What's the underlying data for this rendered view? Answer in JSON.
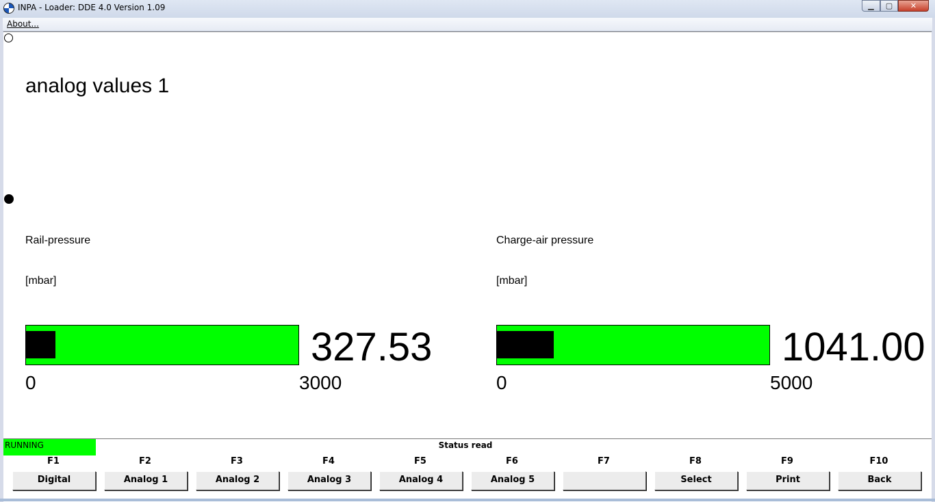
{
  "window": {
    "title": "INPA - Loader:  DDE 4.0 Version 1.09",
    "min_glyph": "▁",
    "max_glyph": "▢",
    "close_glyph": "✕"
  },
  "menu": {
    "about": "About..."
  },
  "page": {
    "title": "analog values 1"
  },
  "gauges": [
    {
      "name": "Rail-pressure",
      "unit": "[mbar]",
      "value": "327.53",
      "min": "0",
      "max": "3000",
      "fill_fraction": 0.1092
    },
    {
      "name": "Charge-air pressure",
      "unit": "[mbar]",
      "value": "1041.00",
      "min": "0",
      "max": "5000",
      "fill_fraction": 0.2082
    }
  ],
  "status": {
    "state": "RUNNING",
    "message": "Status read"
  },
  "fkeys": [
    {
      "key": "F1",
      "label": "Digital"
    },
    {
      "key": "F2",
      "label": "Analog 1"
    },
    {
      "key": "F3",
      "label": "Analog 2"
    },
    {
      "key": "F4",
      "label": "Analog 3"
    },
    {
      "key": "F5",
      "label": "Analog 4"
    },
    {
      "key": "F6",
      "label": "Analog 5"
    },
    {
      "key": "F7",
      "label": ""
    },
    {
      "key": "F8",
      "label": "Select"
    },
    {
      "key": "F9",
      "label": "Print"
    },
    {
      "key": "F10",
      "label": "Back"
    }
  ],
  "colors": {
    "running": "#00ff00",
    "bar": "#00ff00",
    "fill": "#000000"
  }
}
